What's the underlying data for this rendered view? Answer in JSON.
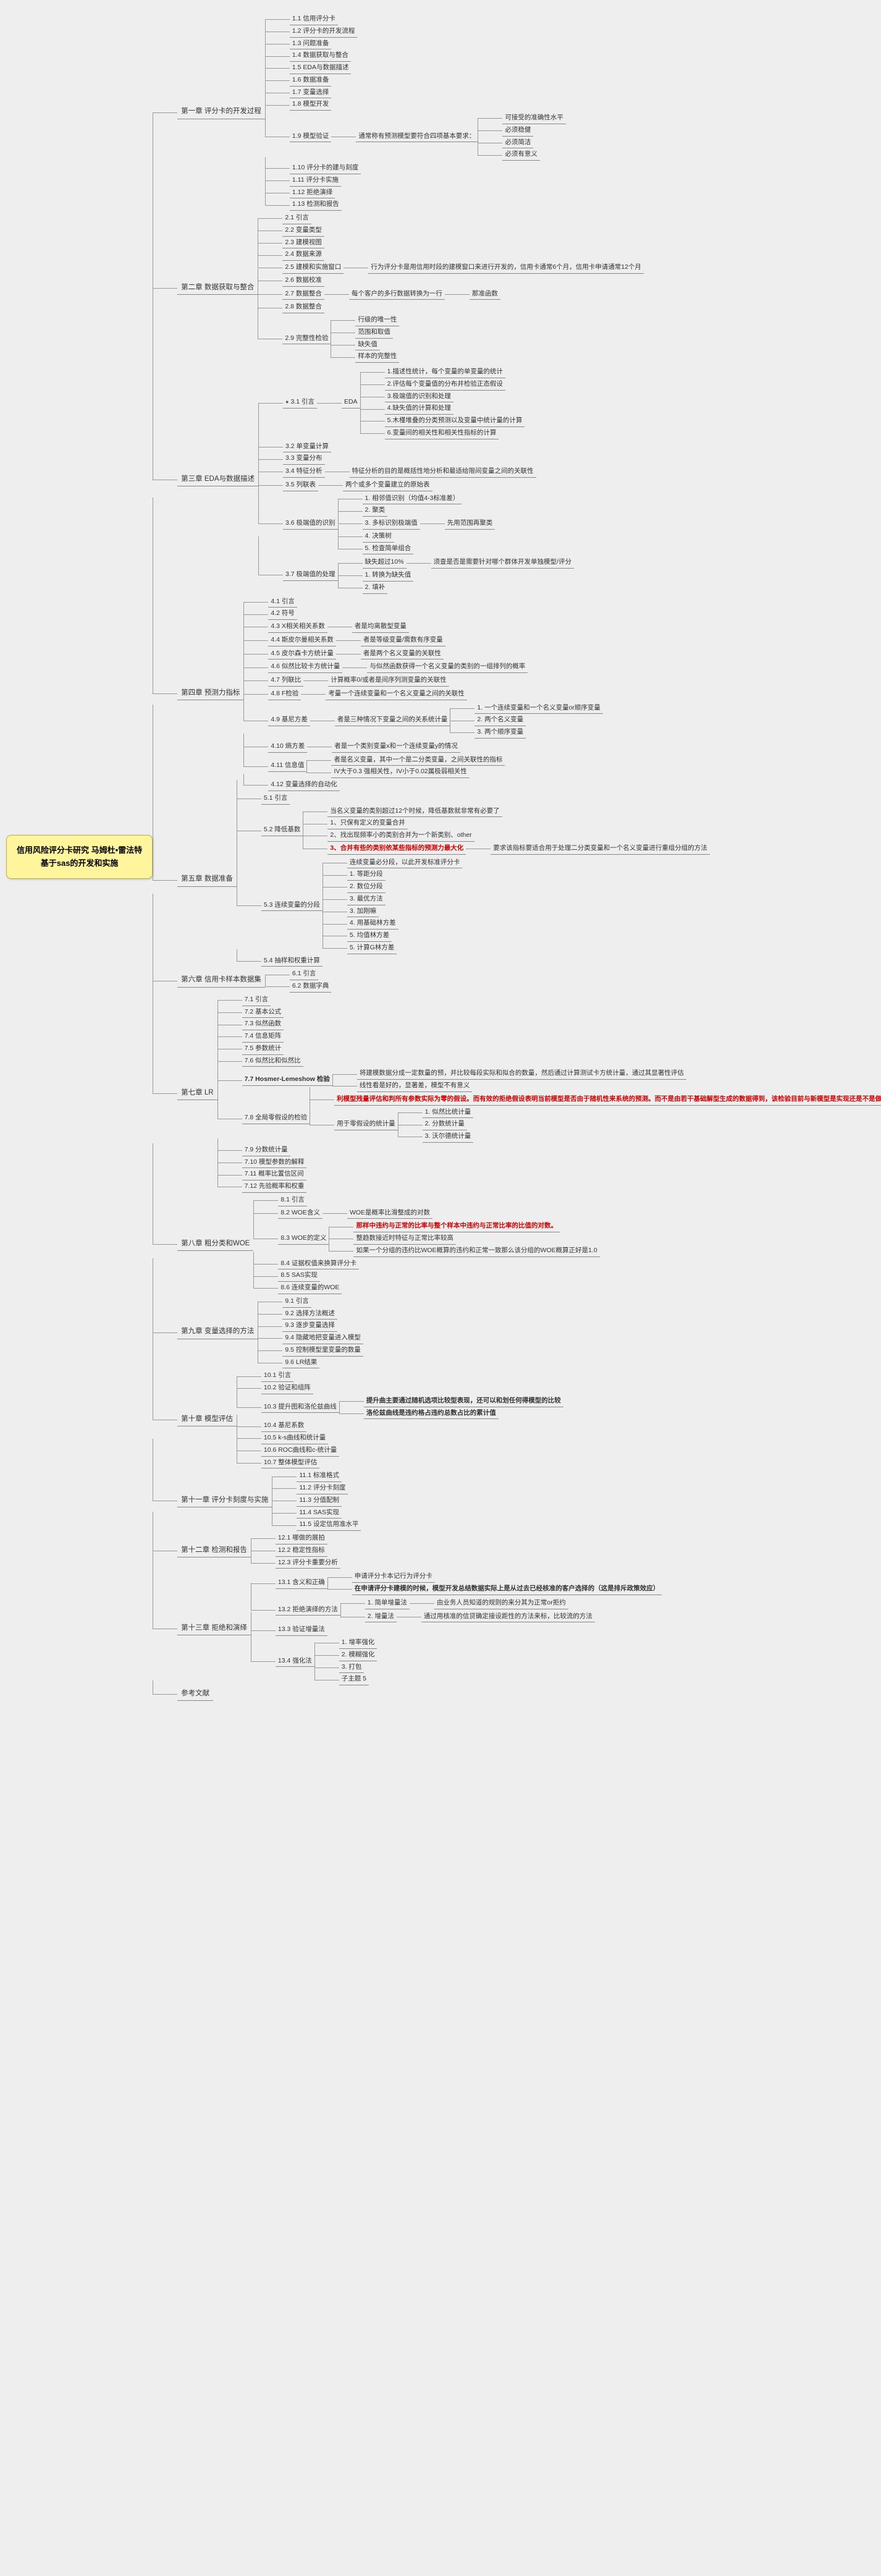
{
  "root": {
    "title_l1": "信用风险评分卡研究 马姆杜•雷法特",
    "title_l2": "基于sas的开发和实施"
  },
  "branches": [
    {
      "title": "第一章 评分卡的开发过程",
      "children": [
        {
          "t": "1.1 信用评分卡"
        },
        {
          "t": "1.2 评分卡的开发流程"
        },
        {
          "t": "1.3 问题准备"
        },
        {
          "t": "1.4 数据获取与整合"
        },
        {
          "t": "1.5 EDA与数据描述"
        },
        {
          "t": "1.6 数据准备"
        },
        {
          "t": "1.7 变量选择"
        },
        {
          "t": "1.8 模型开发"
        },
        {
          "t": "1.9 模型验证",
          "children": [
            {
              "t": "通常称有预测模型要符合四项基本要求：",
              "children": [
                {
                  "t": "可接受的准确性水平"
                },
                {
                  "t": "必须稳健"
                },
                {
                  "t": "必须简洁"
                },
                {
                  "t": "必须有意义"
                }
              ]
            }
          ]
        },
        {
          "t": "1.10 评分卡的建与刻度"
        },
        {
          "t": "1.11 评分卡实施"
        },
        {
          "t": "1.12 拒绝演绎"
        },
        {
          "t": "1.13 检测和报告"
        }
      ]
    },
    {
      "title": "第二章 数据获取与整合",
      "children": [
        {
          "t": "2.1 引言"
        },
        {
          "t": "2.2 变量类型"
        },
        {
          "t": "2.3 建模视图"
        },
        {
          "t": "2.4 数据来源"
        },
        {
          "t": "2.5 建模和实施窗口",
          "children": [
            {
              "t": "行为评分卡是用信用时段的建模窗口来进行开发的，信用卡通常6个月，信用卡申请通常12个月"
            }
          ]
        },
        {
          "t": "2.6 数据校准"
        },
        {
          "t": "2.7 数据整合",
          "children": [
            {
              "t": "每个客户的多行数据转换为一行",
              "children": [
                {
                  "t": "那准函数"
                }
              ]
            }
          ]
        },
        {
          "t": "2.8 数据整合"
        },
        {
          "t": "2.9 完整性检验",
          "children": [
            {
              "t": "行级的唯一性"
            },
            {
              "t": "范围和取值"
            },
            {
              "t": "缺失值"
            },
            {
              "t": "样本的完整性"
            }
          ]
        }
      ]
    },
    {
      "title": "第三章 EDA与数据描述",
      "children": [
        {
          "t": "3.1 引言",
          "marked": true,
          "children": [
            {
              "t": "EDA",
              "children": [
                {
                  "t": "1.描述性统计，每个变量的单变量的统计"
                },
                {
                  "t": "2.评估每个变量值的分布并检验正态假设"
                },
                {
                  "t": "3.极端值的识别和处理"
                },
                {
                  "t": "4.缺失值的计算和处理"
                },
                {
                  "t": "5.木槿堆叠的分类预测以及变量中统计量的计算"
                },
                {
                  "t": "6.变量间的相关性和相关性指标的计算"
                }
              ]
            }
          ]
        },
        {
          "t": "3.2 单变量计算"
        },
        {
          "t": "3.3 变量分布"
        },
        {
          "t": "3.4 特征分析",
          "children": [
            {
              "t": "特征分析的目的是概括性地分析和最适给限间变量之间的关联性"
            }
          ]
        },
        {
          "t": "3.5 列联表",
          "children": [
            {
              "t": "两个或多个变量建立的原始表"
            }
          ]
        },
        {
          "t": "3.6 极端值的识别",
          "children": [
            {
              "t": "1. 相邻值识别（均值4-3标准差）"
            },
            {
              "t": "2. 聚类"
            },
            {
              "t": "3. 多标识别极端值",
              "children": [
                {
                  "t": "先用范围再聚类"
                }
              ]
            },
            {
              "t": "4. 决策树"
            },
            {
              "t": "5. 检查简单组合"
            }
          ]
        },
        {
          "t": "3.7 极端值的处理",
          "children": [
            {
              "t": "缺失超过10%",
              "children": [
                {
                  "t": "须查是否是需要针对哪个群体开发单独模型/评分"
                }
              ]
            },
            {
              "t": "1. 转换为缺失值"
            },
            {
              "t": "2. 填补"
            }
          ]
        }
      ]
    },
    {
      "title": "第四章 预测力指标",
      "children": [
        {
          "t": "4.1 引言"
        },
        {
          "t": "4.2 符号"
        },
        {
          "t": "4.3 X相关相关系数",
          "children": [
            {
              "t": "者是均离散型变量"
            }
          ]
        },
        {
          "t": "4.4 斯皮尔曼相关系数",
          "children": [
            {
              "t": "者是等级变量/需数有序变量"
            }
          ]
        },
        {
          "t": "4.5 皮尔森卡方统计量",
          "children": [
            {
              "t": "者是两个名义变量的关联性"
            }
          ]
        },
        {
          "t": "4.6 似然比较卡方统计量",
          "children": [
            {
              "t": "与似然函数获得一个名义变量的类别的一组排列的概率"
            }
          ]
        },
        {
          "t": "4.7 列联比",
          "children": [
            {
              "t": "计算概率0/或者是间序列测变量的关联性"
            }
          ]
        },
        {
          "t": "4.8 F检验",
          "children": [
            {
              "t": "考量一个连续变量和一个名义变量之间的关联性"
            }
          ]
        },
        {
          "t": "4.9 基尼方差",
          "children": [
            {
              "t": "者是三种情况下变量之间的关系统计量",
              "children": [
                {
                  "t": "1. 一个连续变量和一个名义变量or顺序变量"
                },
                {
                  "t": "2. 两个名义变量"
                },
                {
                  "t": "3. 两个顺序变量"
                }
              ]
            }
          ]
        },
        {
          "t": "4.10 熵方差",
          "children": [
            {
              "t": "者是一个类别变量x和一个连续变量y的情况"
            }
          ]
        },
        {
          "t": "4.11 信息值",
          "children": [
            {
              "t": "者是名义变量，其中一个是二分类变量，之间关联性的指标"
            },
            {
              "t": "IV大于0.3 强相关性，IV小于0.02属极弱相关性"
            }
          ]
        },
        {
          "t": "4.12 变量选择的自动化"
        }
      ]
    },
    {
      "title": "第五章 数据准备",
      "children": [
        {
          "t": "5.1 引言"
        },
        {
          "t": "5.2 降低基数",
          "children": [
            {
              "t": "当名义变量的类别超过12个时候，降低基数就非常有必要了"
            },
            {
              "t": "1、只保有定义的变量合并"
            },
            {
              "t": "2、找出现频率小的类别合并为一个新类别、other"
            },
            {
              "t": "3、合并有些的类别依某些指标的预测力最大化",
              "red": true,
              "children": [
                {
                  "t": "要求该指标要适合用于处理二分类变量和一个名义变量进行重组分组的方法"
                }
              ]
            }
          ]
        },
        {
          "t": "5.3 连续变量的分段",
          "children": [
            {
              "t": "连续变量必分段，以此开发标准评分卡"
            },
            {
              "t": "1. 等距分段"
            },
            {
              "t": "2. 数位分段"
            },
            {
              "t": "3. 最优方法"
            },
            {
              "t": "3. 加刚嘛"
            },
            {
              "t": "4. 用基础林方差"
            },
            {
              "t": "5. 均值林方差"
            },
            {
              "t": "5. 计算G林方差"
            }
          ]
        },
        {
          "t": "5.4 抽样和权重计算"
        }
      ]
    },
    {
      "title": "第六章 信用卡样本数据集",
      "children": [
        {
          "t": "6.1 引言"
        },
        {
          "t": "6.2 数据字典"
        }
      ]
    },
    {
      "title": "第七章 LR",
      "children": [
        {
          "t": "7.1 引言"
        },
        {
          "t": "7.2 基本公式"
        },
        {
          "t": "7.3 似然函数"
        },
        {
          "t": "7.4 信息矩阵"
        },
        {
          "t": "7.5 参数统计"
        },
        {
          "t": "7.6 似然比和似然比"
        },
        {
          "t": "7.7 Hosmer-Lemeshow 检验",
          "bold": true,
          "children": [
            {
              "t": "将建模数据分成一定数量的预，并比较每段实际和拟合的数量，然后通过计算测试卡方统计量，通过其显著性评估"
            },
            {
              "t": "线性看是好的，显著差，模型不有意义"
            }
          ]
        },
        {
          "t": "7.8 全局零假设的检验",
          "children": [
            {
              "t": "利模型残量评估和判所有参数实际为零的假设。而有效的拒绝假设表明当前模型是否由于随机性来系统的预测。而不是由若干基础解型生成的数据得到，该检验目前与新模型是实现还是不是做拒绝响的一个独准工具",
              "red": true
            },
            {
              "t": "用于零假设的统计量",
              "children": [
                {
                  "t": "1. 似然比统计量"
                },
                {
                  "t": "2. 分数统计量"
                },
                {
                  "t": "3. 沃尔德统计量"
                }
              ]
            }
          ]
        },
        {
          "t": "7.9 分数统计量"
        },
        {
          "t": "7.10 模型参数的解释"
        },
        {
          "t": "7.11 概率比置信区间"
        },
        {
          "t": "7.12 先验概率和权重"
        }
      ]
    },
    {
      "title": "第八章 粗分类和WOE",
      "children": [
        {
          "t": "8.1 引言"
        },
        {
          "t": "8.2 WOE含义",
          "children": [
            {
              "t": "WOE是概率比滑整成的对数"
            }
          ]
        },
        {
          "t": "8.3 WOE的定义",
          "children": [
            {
              "t": "那样中违约与正常的比率与整个样本中违约与正常比率的比值的对数。",
              "red": true
            },
            {
              "t": "整趋数接近时特征与正常比率较高"
            },
            {
              "t": "如果一个分组的违约比WOE概算的违约和正常一致那么该分组的WOE概算正好是1.0"
            }
          ]
        },
        {
          "t": "8.4 证据权值来换算评分卡"
        },
        {
          "t": "8.5 SAS实现"
        },
        {
          "t": "8.6 连续变量的WOE"
        }
      ]
    },
    {
      "title": "第九章 变量选择的方法",
      "children": [
        {
          "t": "9.1 引言"
        },
        {
          "t": "9.2 选择方法概述"
        },
        {
          "t": "9.3 逐步变量选择"
        },
        {
          "t": "9.4 隐藏地把变量进入模型"
        },
        {
          "t": "9.5 控制模型里变量的数量"
        },
        {
          "t": "9.6 LR结果"
        }
      ]
    },
    {
      "title": "第十章 模型评估",
      "children": [
        {
          "t": "10.1 引言"
        },
        {
          "t": "10.2 验证和组阵"
        },
        {
          "t": "10.3 提升图和洛伦兹曲线",
          "children": [
            {
              "t": "提升曲主要通过随机选项比较型表现，还可以和划任何得模型的比较",
              "bold": true
            },
            {
              "t": "洛伦兹曲线是违约格占违约总数占比的累计值",
              "bold": true
            }
          ]
        },
        {
          "t": "10.4 基尼系数"
        },
        {
          "t": "10.5 k-s曲线和统计量"
        },
        {
          "t": "10.6 ROC曲线和c-统计量"
        },
        {
          "t": "10.7 整体模型评估"
        }
      ]
    },
    {
      "title": "第十一章 评分卡刻度与实施",
      "children": [
        {
          "t": "11.1 标准格式"
        },
        {
          "t": "11.2 评分卡刻度"
        },
        {
          "t": "11.3 分值配制"
        },
        {
          "t": "11.4 SAS实现"
        },
        {
          "t": "11.5 设定信用准水平"
        }
      ]
    },
    {
      "title": "第十二章 检测和报告",
      "children": [
        {
          "t": "12.1 哪做的展拍"
        },
        {
          "t": "12.2 稳定性指标"
        },
        {
          "t": "12.3 评分卡重要分析"
        }
      ]
    },
    {
      "title": "第十三章 拒绝和演绎",
      "children": [
        {
          "t": "13.1 含义和正确",
          "children": [
            {
              "t": "申请评分卡本记行为评分卡"
            },
            {
              "t": "在申请评分卡建模的时候，模型开发总结数据实际上是从过去已经核准的客户选择的（这是排斥政策效应）",
              "bold": true
            }
          ]
        },
        {
          "t": "13.2 拒绝演绎的方法",
          "children": [
            {
              "t": "1. 简单增量法",
              "children": [
                {
                  "t": "由业务人员知道的规则的来分其为正常or拒约"
                }
              ]
            },
            {
              "t": "2. 增量法",
              "children": [
                {
                  "t": "通过用核准的信贷确定接设距性的方法来标，比较流的方法"
                }
              ]
            }
          ]
        },
        {
          "t": "13.3 验证增量法"
        },
        {
          "t": "13.4 强化法",
          "children": [
            {
              "t": "1. 增率强化"
            },
            {
              "t": "2. 模糊强化"
            },
            {
              "t": "3. 打包"
            },
            {
              "t": "子主题 5"
            }
          ]
        }
      ]
    },
    {
      "title": "参考文献",
      "children": []
    }
  ]
}
